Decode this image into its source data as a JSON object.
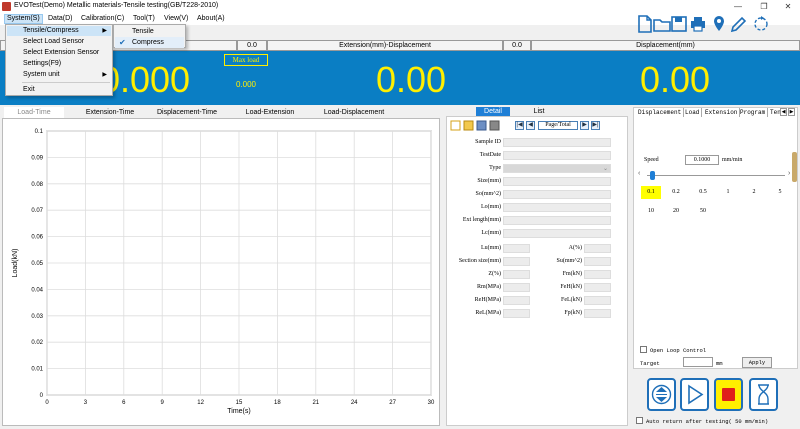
{
  "window": {
    "title": "EVOTest(Demo) Metallic materials-Tensile testing(GB/T228-2010)",
    "controls": [
      "—",
      "❐",
      "✕"
    ]
  },
  "menu": {
    "items": [
      "System(S)",
      "Data(D)",
      "Calibration(C)",
      "Tool(T)",
      "View(V)",
      "About(A)"
    ],
    "system_dropdown": {
      "items": [
        "Tensile/Compress",
        "Select Load Sensor",
        "Select Extension Sensor",
        "Settings(F9)",
        "System unit",
        "Exit"
      ]
    },
    "submenu": {
      "items": [
        "Tensile",
        "Compress"
      ],
      "checked": "Compress"
    }
  },
  "toolbar": {
    "icons": [
      "new-file-icon",
      "open-folder-icon",
      "save-icon",
      "print-icon",
      "location-pin-icon",
      "edit-pencil-icon",
      "rotate-view-icon"
    ],
    "accent": "#1f6fb8"
  },
  "readout": {
    "panels": [
      {
        "head_value": "",
        "big": "0.000"
      },
      {
        "head_value": "0.0",
        "head_label": "Extension(mm)-Displacement",
        "big": "0.00"
      },
      {
        "head_value": "0.0",
        "head_label": "Displacement(mm)",
        "big": "0.00"
      }
    ],
    "max_load_label": "Max load",
    "max_load_value": "0.000",
    "bg_color": "#0a7ec4",
    "digit_color": "#ffef00"
  },
  "chart_tabs": [
    "Load-Time",
    "Extension-Time",
    "Displacement-Time",
    "Load-Extension",
    "Load-Displacement"
  ],
  "chart_data": {
    "type": "line",
    "x": [],
    "series": [],
    "xlabel": "Time(s)",
    "ylabel": "Load(kN)",
    "xlim": [
      0,
      30
    ],
    "ylim": [
      0,
      0.1
    ],
    "xticks": [
      "0",
      "3",
      "6",
      "9",
      "12",
      "15",
      "18",
      "21",
      "24",
      "27",
      "30"
    ],
    "yticks": [
      "0",
      "0.01",
      "0.02",
      "0.03",
      "0.04",
      "0.05",
      "0.06",
      "0.07",
      "0.08",
      "0.09",
      "0.1"
    ],
    "grid": true
  },
  "detail": {
    "tabs": [
      "Detail",
      "List"
    ],
    "page_label": "Page/Total",
    "fields": [
      "Sample ID",
      "TestDate",
      "Type",
      "Size(mm)",
      "So(mm^2)",
      "Lo(mm)",
      "Ext length(mm)",
      "Lc(mm)"
    ],
    "pair_fields": [
      [
        "Lu(mm)",
        "A(%)"
      ],
      [
        "Section size(mm)",
        "Su(mm^2)"
      ],
      [
        "Z(%)",
        "Fm(kN)"
      ],
      [
        "Rm(MPa)",
        "FeH(kN)"
      ],
      [
        "ReH(MPa)",
        "FeL(kN)"
      ],
      [
        "ReL(MPa)",
        "Fp(kN)"
      ]
    ]
  },
  "control": {
    "tabs": [
      "Displacement",
      "Load",
      "Extension",
      "Program",
      "Ten"
    ],
    "speed_label": "Speed",
    "speed_value": "0.1000",
    "speed_unit": "mm/min",
    "speed_options": [
      "0.1",
      "0.2",
      "0.5",
      "1",
      "2",
      "5",
      "10",
      "20",
      "50"
    ],
    "selected_speed": "0.1",
    "open_loop_label": "Open Loop Control",
    "target_label": "Target",
    "target_unit": "mm",
    "apply_label": "Apply",
    "auto_return_label": "Auto return after testing( 50   mm/min)"
  }
}
